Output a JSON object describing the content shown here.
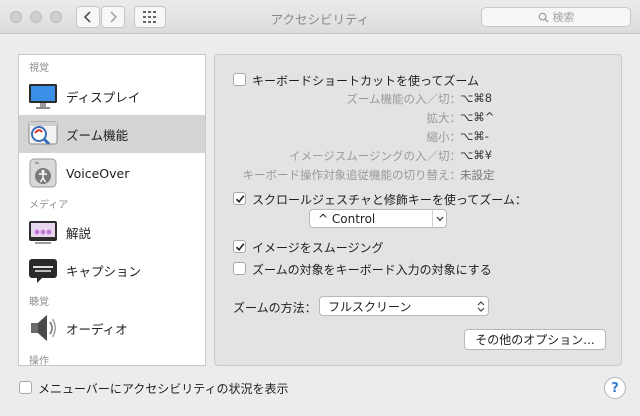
{
  "window": {
    "title": "アクセシビリティ"
  },
  "search": {
    "placeholder": "検索"
  },
  "sidebar": {
    "categories": {
      "vision": "視覚",
      "media": "メディア",
      "hearing": "聴覚",
      "interaction": "操作"
    },
    "items": [
      {
        "label": "ディスプレイ"
      },
      {
        "label": "ズーム機能"
      },
      {
        "label": "VoiceOver"
      },
      {
        "label": "解説"
      },
      {
        "label": "キャプション"
      },
      {
        "label": "オーディオ"
      }
    ]
  },
  "zoom": {
    "keyboard_shortcuts_label": "キーボードショートカットを使ってズーム",
    "shortcuts": [
      {
        "label": "ズーム機能の入／切：",
        "keys": "⌥⌘8"
      },
      {
        "label": "拡大：",
        "keys": "⌥⌘^"
      },
      {
        "label": "縮小：",
        "keys": "⌥⌘-"
      },
      {
        "label": "イメージスムージングの入／切：",
        "keys": "⌥⌘¥"
      },
      {
        "label": "キーボード操作対象追従機能の切り替え：",
        "keys": "未設定"
      }
    ],
    "scroll_gesture_label": "スクロールジェスチャと修飾キーを使ってズーム：",
    "modifier_value": "^ Control",
    "smooth_images_label": "イメージをスムージング",
    "follow_focus_label": "ズームの対象をキーボード入力の対象にする",
    "zoom_style_label": "ズームの方法：",
    "zoom_style_value": "フルスクリーン",
    "more_options_label": "その他のオプション..."
  },
  "footer": {
    "show_menu_status_label": "メニューバーにアクセシビリティの状況を表示",
    "help_label": "?"
  },
  "colors": {
    "accent": "#3a7bd5",
    "selection": "#d4d4d4"
  }
}
